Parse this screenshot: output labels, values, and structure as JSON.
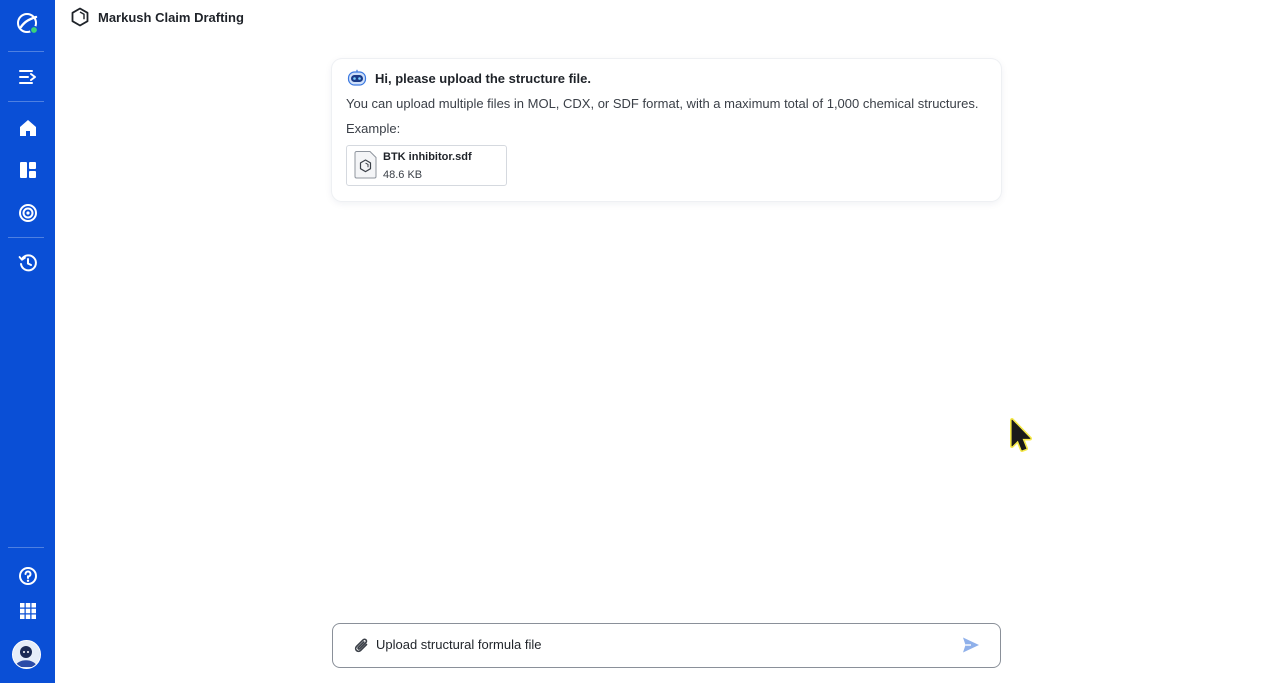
{
  "app": {
    "title": "Markush Claim Drafting"
  },
  "sidebar": {
    "logo": "app-logo-icon",
    "items": [
      {
        "name": "collapse-menu",
        "icon": "menu-collapse-icon"
      },
      {
        "name": "home",
        "icon": "home-icon"
      },
      {
        "name": "dashboard",
        "icon": "dashboard-icon"
      },
      {
        "name": "radar",
        "icon": "radar-icon"
      },
      {
        "name": "history",
        "icon": "history-icon"
      }
    ],
    "bottom": [
      {
        "name": "help",
        "icon": "help-icon"
      },
      {
        "name": "apps",
        "icon": "grid-icon"
      }
    ],
    "accent": "#0a4fd6"
  },
  "message": {
    "greeting": "Hi, please upload the structure file.",
    "description": "You can upload multiple files in MOL, CDX, or SDF format, with a maximum total of 1,000 chemical structures.",
    "example_label": "Example:",
    "example_file": {
      "name": "BTK inhibitor.sdf",
      "size": "48.6 KB"
    }
  },
  "composer": {
    "placeholder": "Upload structural formula file"
  }
}
